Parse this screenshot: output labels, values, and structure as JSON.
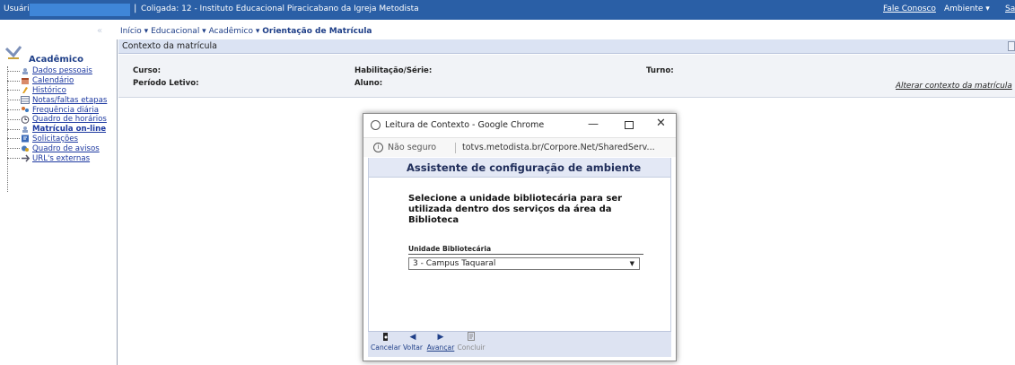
{
  "topbar": {
    "user_label": "Usuário:",
    "separator": "|",
    "coligada": "Coligada: 12 - Instituto Educacional Piracicabano da Igreja Metodista",
    "fale_conosco": "Fale Conosco",
    "ambiente": "Ambiente ▾",
    "sair": "Sair"
  },
  "breadcrumb": {
    "arrows": "«",
    "items": [
      "Início ▾",
      "Educacional ▾",
      "Acadêmico ▾"
    ],
    "current": "Orientação de Matrícula"
  },
  "sidebar": {
    "title": "Acadêmico",
    "items": [
      {
        "label": "Dados pessoais",
        "icon": "user-icon"
      },
      {
        "label": "Calendário",
        "icon": "calendar-icon"
      },
      {
        "label": "Histórico",
        "icon": "history-icon"
      },
      {
        "label": "Notas/faltas etapas",
        "icon": "grades-icon"
      },
      {
        "label": "Frequência diária",
        "icon": "attendance-icon"
      },
      {
        "label": "Quadro de horários",
        "icon": "clock-icon"
      },
      {
        "label": "Matrícula on-line",
        "icon": "enroll-icon"
      },
      {
        "label": "Solicitações",
        "icon": "requests-icon"
      },
      {
        "label": "Quadro de avisos",
        "icon": "notices-icon"
      },
      {
        "label": "URL's externas",
        "icon": "link-icon"
      }
    ]
  },
  "context": {
    "header": "Contexto da matrícula",
    "curso_label": "Curso:",
    "periodo_label": "Período Letivo:",
    "habilitacao_label": "Habilitação/Série:",
    "aluno_label": "Aluno:",
    "turno_label": "Turno:",
    "alterar_link": "Alterar contexto da matrícula"
  },
  "popup": {
    "window_title": "Leitura de Contexto - Google Chrome",
    "not_secure": "Não seguro",
    "url": "totvs.metodista.br/Corpore.Net/SharedServ...",
    "assistant_title": "Assistente de configuração de ambiente",
    "question": "Selecione a unidade bibliotecária para ser utilizada dentro dos serviços da área da Biblioteca",
    "field_label": "Unidade Bibliotecária",
    "selected_value": "3 - Campus Taquaral",
    "buttons": {
      "cancel": "Cancelar",
      "back": "Voltar",
      "next": "Avançar",
      "finish": "Concluir"
    }
  },
  "colors": {
    "topbar": "#2a5fa6",
    "link": "#1c38a0",
    "panel_header": "#dbe3f3",
    "footer": "#dde3f2"
  }
}
